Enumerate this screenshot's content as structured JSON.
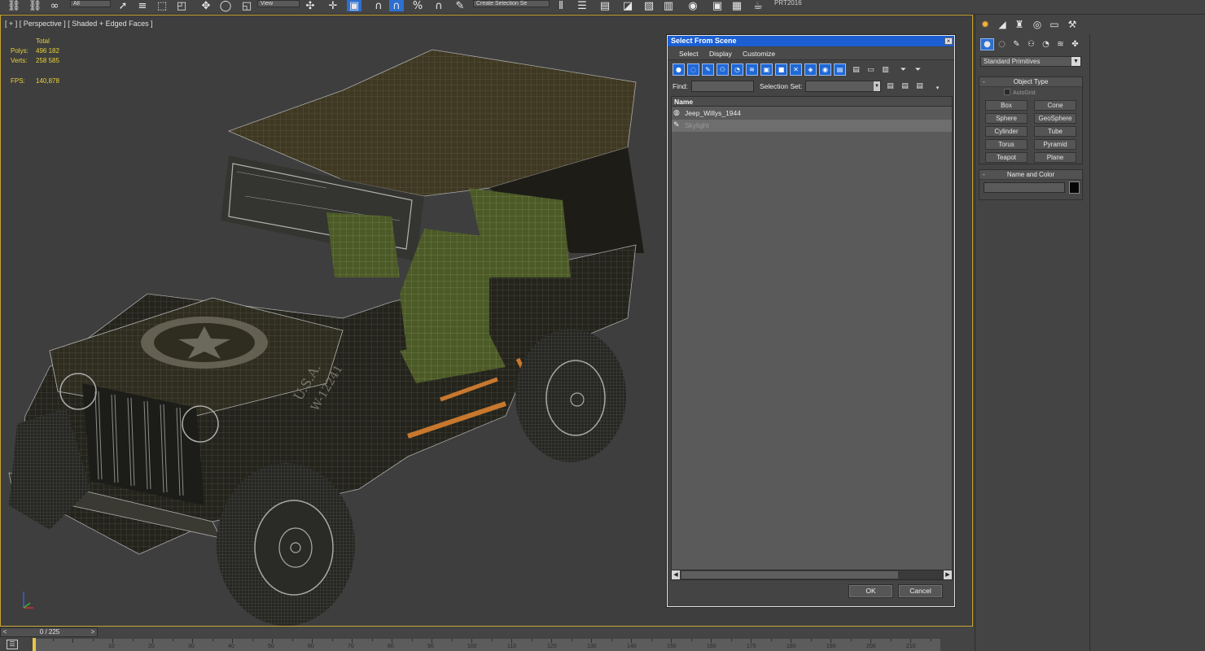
{
  "toolbar": {
    "view_combo": "View",
    "all_combo": "All",
    "selection_set_combo": "Create Selection Se",
    "prt_label": "PRT2016"
  },
  "viewport": {
    "label": "[ + ] [ Perspective ] [ Shaded + Edged Faces ]",
    "stats": {
      "total_label": "Total",
      "polys_label": "Polys:",
      "polys_value": "496 182",
      "verts_label": "Verts:",
      "verts_value": "258 585",
      "fps_label": "FPS:",
      "fps_value": "140,878"
    },
    "model": {
      "hood_text": "U.S.A.",
      "hood_number": "W-12241"
    },
    "axis": {
      "x": "x",
      "y": "y",
      "z": "z"
    }
  },
  "command_panel": {
    "dropdown_value": "Standard Primitives",
    "object_type": {
      "title": "Object Type",
      "autogrid_label": "AutoGrid",
      "buttons": [
        "Box",
        "Cone",
        "Sphere",
        "GeoSphere",
        "Cylinder",
        "Tube",
        "Torus",
        "Pyramid",
        "Teapot",
        "Plane"
      ]
    },
    "name_color": {
      "title": "Name and Color",
      "swatch_color": "#050505"
    }
  },
  "dialog": {
    "title": "Select From Scene",
    "close": "×",
    "menu": [
      "Select",
      "Display",
      "Customize"
    ],
    "find_label": "Find:",
    "find_value": "",
    "selection_set_label": "Selection Set:",
    "selection_set_value": "",
    "list_header": "Name",
    "rows": [
      {
        "name": "Jeep_Willys_1944",
        "selected": false
      },
      {
        "name": "Skylight",
        "selected": true
      }
    ],
    "ok_label": "OK",
    "cancel_label": "Cancel"
  },
  "timeline": {
    "frame_label": "0 / 225",
    "ticks": [
      "10",
      "20",
      "30",
      "40",
      "50",
      "60",
      "70",
      "80",
      "90",
      "100",
      "110",
      "120",
      "130",
      "140",
      "150",
      "160",
      "170",
      "180",
      "190",
      "200",
      "210",
      "220"
    ]
  },
  "colors": {
    "selection_accent": "#1b5fd3",
    "viewport_border": "#c7a332",
    "stats_text": "#e8d23a",
    "model_khaki": "#3c3a22",
    "seat_olive": "#4b5a26",
    "orange_part": "#c8782e"
  }
}
